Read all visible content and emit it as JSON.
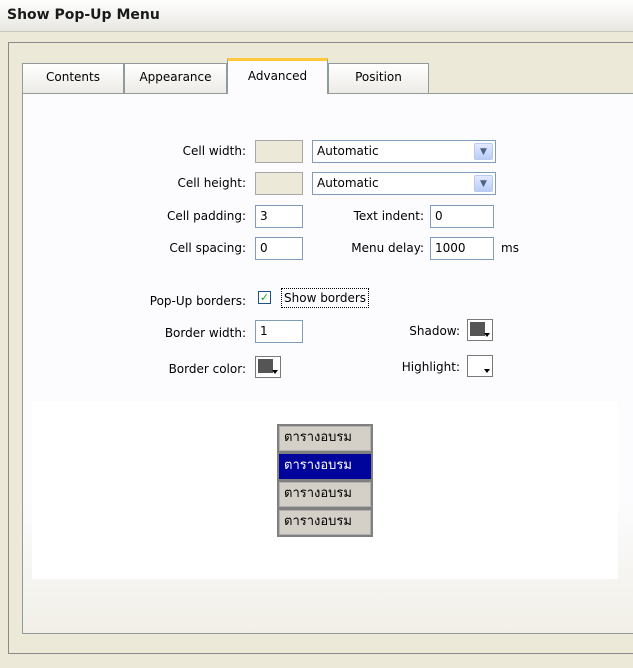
{
  "title": "Show Pop-Up Menu",
  "tabs": [
    "Contents",
    "Appearance",
    "Advanced",
    "Position"
  ],
  "active_tab": "Advanced",
  "fields": {
    "cell_width": {
      "label": "Cell width:",
      "value": "",
      "mode": "Automatic"
    },
    "cell_height": {
      "label": "Cell height:",
      "value": "",
      "mode": "Automatic"
    },
    "cell_padding": {
      "label": "Cell padding:",
      "value": "3"
    },
    "cell_spacing": {
      "label": "Cell spacing:",
      "value": "0"
    },
    "text_indent": {
      "label": "Text indent:",
      "value": "0"
    },
    "menu_delay": {
      "label": "Menu delay:",
      "value": "1000",
      "unit": "ms"
    },
    "popup_borders": {
      "label": "Pop-Up borders:",
      "checked": true,
      "checkbox_label": "Show borders"
    },
    "border_width": {
      "label": "Border width:",
      "value": "1"
    },
    "border_color": {
      "label": "Border color:",
      "color": "#555555"
    },
    "shadow": {
      "label": "Shadow:",
      "color": "#555555"
    },
    "highlight": {
      "label": "Highlight:",
      "color": "#ffffff"
    }
  },
  "preview": {
    "items": [
      "ตารางอบรม",
      "ตารางอบรม",
      "ตารางอบรม",
      "ตารางอบรม"
    ],
    "highlighted_index": 1,
    "item_bg": "#d4d0c8",
    "highlight_bg": "#00049a"
  },
  "icons": {
    "dropdown": "chevron-down-icon",
    "check": "checkmark-icon",
    "color_arrow": "dropdown-arrow-icon"
  }
}
